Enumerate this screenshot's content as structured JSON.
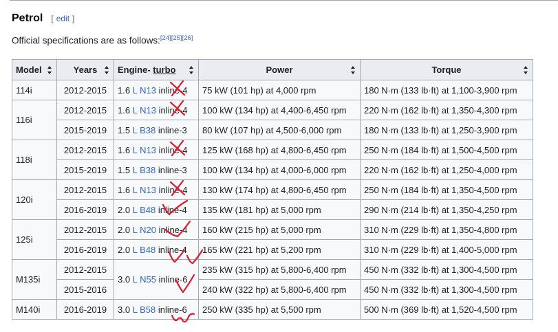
{
  "section": {
    "title": "Petrol",
    "edit_open": "[",
    "edit_label": "edit",
    "edit_close": "]"
  },
  "intro": {
    "text": "Official specifications are as follows:",
    "refs": [
      "[24]",
      "[25]",
      "[26]"
    ]
  },
  "table": {
    "headers": {
      "model": "Model",
      "years": "Years",
      "engine_prefix": "Engine- ",
      "engine_link": "turbo",
      "power": "Power",
      "torque": "Torque"
    },
    "rows": [
      {
        "model": "114i",
        "years": "2012-2015",
        "disp": "1.6",
        "unit": "L",
        "code": "N13",
        "layout": "inline-4",
        "power": "75 kW (101 hp) at 4,000 rpm",
        "torque": "180 N·m (133 lb·ft) at 1,100-3,900 rpm"
      },
      {
        "model": "116i",
        "years": "2012-2015",
        "disp": "1.6",
        "unit": "L",
        "code": "N13",
        "layout": "inline-4",
        "power": "100 kW (134 hp) at 4,400-6,450 rpm",
        "torque": "220 N·m (162 lb·ft) at 1,350-4,300 rpm"
      },
      {
        "model": "",
        "years": "2015-2019",
        "disp": "1.5",
        "unit": "L",
        "code": "B38",
        "layout": "inline-3",
        "power": "80 kW (107 hp) at 4,500-6,000 rpm",
        "torque": "180 N·m (133 lb·ft) at 1,250-3,900 rpm"
      },
      {
        "model": "118i",
        "years": "2012-2015",
        "disp": "1.6",
        "unit": "L",
        "code": "N13",
        "layout": "inline-4",
        "power": "125 kW (168 hp) at 4,800-6,450 rpm",
        "torque": "250 N·m (184 lb·ft) at 1,500-4,500 rpm"
      },
      {
        "model": "",
        "years": "2015-2019",
        "disp": "1.5",
        "unit": "L",
        "code": "B38",
        "layout": "inline-3",
        "power": "100 kW (134 hp) at 4,000-6,000 rpm",
        "torque": "220 N·m (162 lb·ft) at 1,250-4,000 rpm"
      },
      {
        "model": "120i",
        "years": "2012-2015",
        "disp": "1.6",
        "unit": "L",
        "code": "N13",
        "layout": "inline-4",
        "power": "130 kW (174 hp) at 4,800-6,450 rpm",
        "torque": "250 N·m (184 lb·ft) at 1,350-4,500 rpm"
      },
      {
        "model": "",
        "years": "2016-2019",
        "disp": "2.0",
        "unit": "L",
        "code": "B48",
        "layout": "inline-4",
        "power": "135 kW (181 hp) at 5,000 rpm",
        "torque": "290 N·m (214 lb·ft) at 1,350-4,250 rpm"
      },
      {
        "model": "125i",
        "years": "2012-2015",
        "disp": "2.0",
        "unit": "L",
        "code": "N20",
        "layout": "inline-4",
        "power": "160 kW (215 hp) at 5,000 rpm",
        "torque": "310 N·m (229 lb·ft) at 1,350-4,800 rpm"
      },
      {
        "model": "",
        "years": "2016-2019",
        "disp": "2.0",
        "unit": "L",
        "code": "B48",
        "layout": "inline-4",
        "power": "165 kW (221 hp) at 5,200 rpm",
        "torque": "310 N·m (229 lb·ft) at 1,400-5,000 rpm"
      },
      {
        "model": "M135i",
        "years": "2012-2015",
        "disp": "3.0",
        "unit": "L",
        "code": "N55",
        "layout": "inline-6",
        "power": "235 kW (315 hp) at 5,800-6,400 rpm",
        "torque": "450 N·m (332 lb·ft) at 1,300-4,500 rpm"
      },
      {
        "model": "",
        "years": "2015-2016",
        "disp": "",
        "unit": "",
        "code": "",
        "layout": "",
        "power": "240 kW (322 hp) at 5,800-6,400 rpm",
        "torque": "450 N·m (332 lb·ft) at 1,300-4,500 rpm"
      },
      {
        "model": "M140i",
        "years": "2016-2019",
        "disp": "3.0",
        "unit": "L",
        "code": "B58",
        "layout": "inline-6",
        "power": "250 kW (335 hp) at 5,500 rpm",
        "torque": "500 N·m (369 lb·ft) at 1,520-4,500 rpm"
      }
    ]
  },
  "annotation_color": "#e0182d"
}
